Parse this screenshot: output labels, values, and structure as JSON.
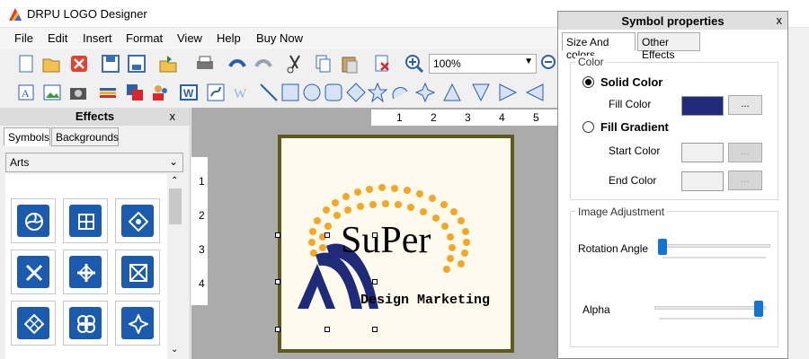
{
  "app": {
    "title": "DRPU LOGO Designer"
  },
  "menu": [
    "File",
    "Edit",
    "Insert",
    "Format",
    "View",
    "Help",
    "Buy Now"
  ],
  "toolbar": {
    "zoom_value": "100%"
  },
  "effects_panel": {
    "title": "Effects",
    "close": "x",
    "tabs": [
      "Symbols",
      "Backgrounds"
    ],
    "category": "Arts"
  },
  "ruler": {
    "top_labels": [
      "1",
      "2",
      "3",
      "4",
      "5"
    ],
    "left_labels": [
      "1",
      "2",
      "3",
      "4"
    ]
  },
  "logo": {
    "main_text": "SuPer",
    "sub_text": "Design Marketing"
  },
  "props_panel": {
    "title": "Symbol properties",
    "close": "x",
    "tabs": [
      "Size And colors",
      "Other Effects"
    ],
    "color_group": "Color",
    "solid_color": "Solid Color",
    "fill_color": "Fill Color",
    "fill_gradient": "Fill Gradient",
    "start_color": "Start Color",
    "end_color": "End Color",
    "dots": "...",
    "image_adjustment": "Image Adjustment",
    "rotation_angle": "Rotation Angle",
    "alpha": "Alpha",
    "rotation_value": 0,
    "alpha_value": 1,
    "fill_color_hex": "#1f2a78"
  },
  "colors": {
    "accent": "#1275d3",
    "symbol_blue": "#1a5bb0",
    "page_border": "#5d5a1c",
    "logo_orange": "#f5a623",
    "logo_navy": "#1f2a78"
  }
}
